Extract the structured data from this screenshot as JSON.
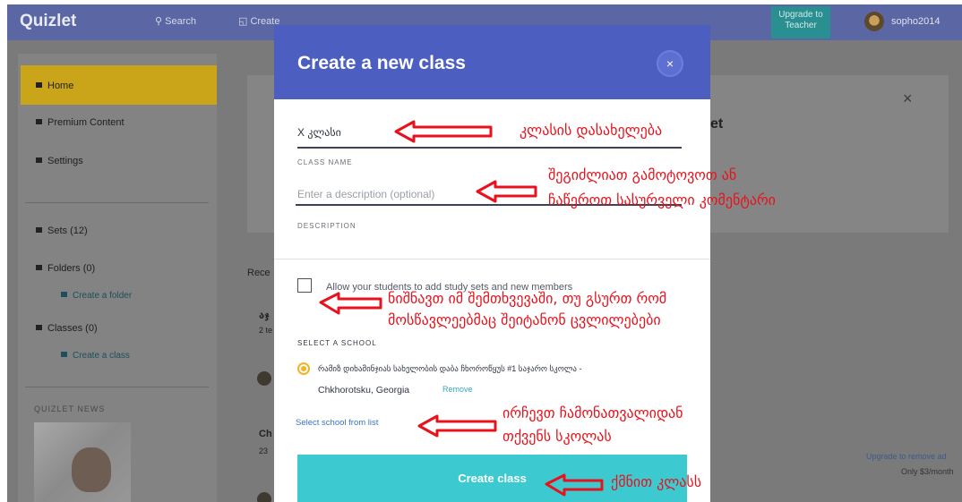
{
  "app": {
    "logo": "Quizlet",
    "search_label": "Search",
    "create_label": "Create",
    "upgrade_label": "Upgrade to Teacher",
    "username": "sopho2014",
    "topbar_color": "#5a67a4"
  },
  "sidebar": {
    "home": "Home",
    "premium": "Premium Content",
    "settings": "Settings",
    "sets": "Sets (12)",
    "folders": "Folders (0)",
    "create_folder": "Create a folder",
    "classes": "Classes (0)",
    "create_class": "Create a class",
    "news_label": "QUIZLET NEWS",
    "home_color": "#caa519"
  },
  "main": {
    "recent_label": "Rece",
    "card1_title": "აჯ",
    "card1_sub": "2 te",
    "card2_title": "Ch",
    "card2_sub": "23",
    "heading_fragment": "et",
    "upgrade_remove": "Upgrade to remove ad",
    "price": "Only $3/month",
    "close_symbol": "×"
  },
  "modal": {
    "title": "Create a new class",
    "close_symbol": "×",
    "header_color": "#4c5fc1",
    "class_name_value": "X კლასი",
    "class_name_label": "CLASS NAME",
    "description_placeholder": "Enter a description (optional)",
    "description_label": "DESCRIPTION",
    "allow_text": "Allow your students to add study sets and new members",
    "allow_checked": false,
    "select_school_label": "SELECT A SCHOOL",
    "school_name": "რამიზ დიხამინჯიას სახელობის დაბა ჩხოროწყუს #1 საჯარო სკოლა -",
    "school_city": "Chkhorotsku, Georgia",
    "remove_label": "Remove",
    "select_from_list": "Select school from list",
    "create_button": "Create class",
    "button_color": "#3ccad0"
  },
  "annotations": {
    "class_name": "კლასის დასახელება",
    "description_line1": "შეგიძლიათ გამოტოვოთ ან",
    "description_line2": "ჩაწეროთ სასურველი კომენტარი",
    "checkbox_line1": "ნიშნავთ იმ შემთხვევაში, თუ გსურთ რომ",
    "checkbox_line2": "მოსწავლეებმაც შეიტანონ ცვლილებები",
    "school_line1": "ირჩევთ ჩამონათვალიდან",
    "school_line2": "თქვენს სკოლას",
    "create": "ქმნით კლასს",
    "color": "#e8121c"
  }
}
